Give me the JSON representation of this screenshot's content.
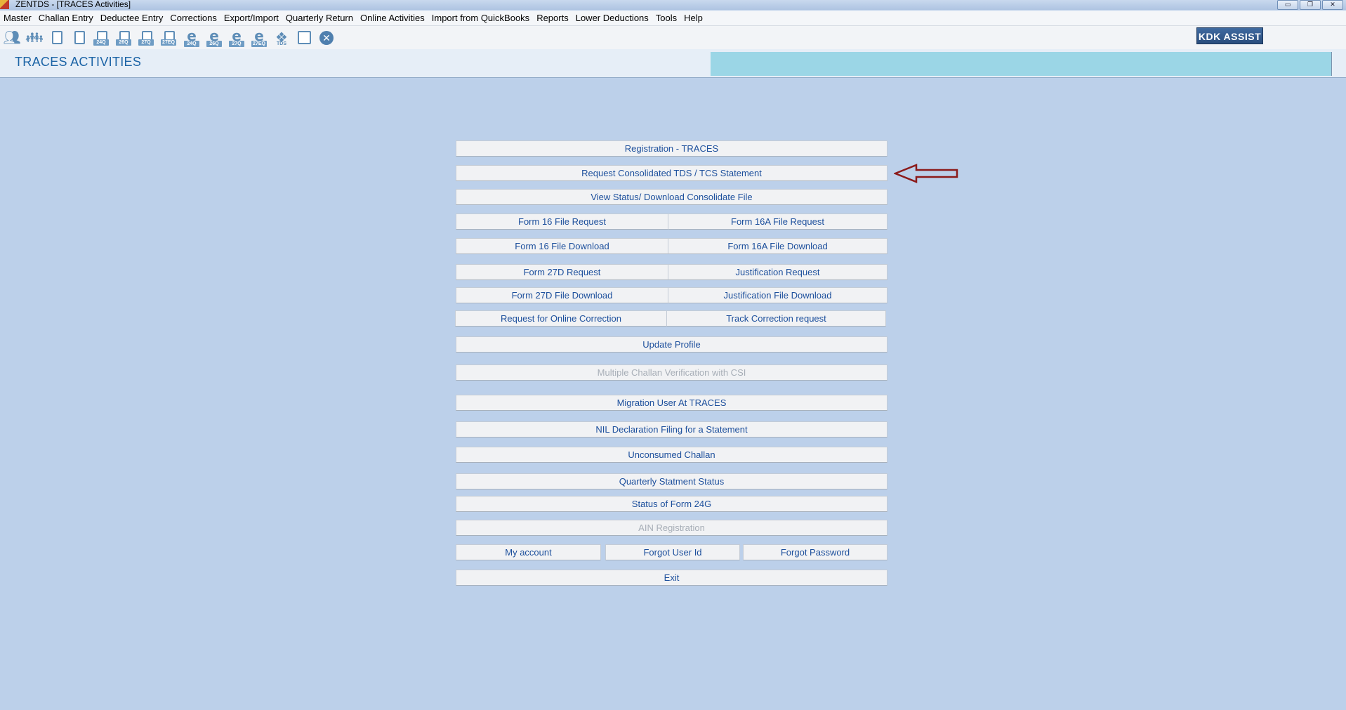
{
  "window": {
    "title": "ZENTDS - [TRACES Activities]",
    "controls": [
      "▭",
      "❐",
      "✕"
    ]
  },
  "menu": [
    "Master",
    "Challan Entry",
    "Deductee Entry",
    "Corrections",
    "Export/Import",
    "Quarterly Return",
    "Online Activities",
    "Import from QuickBooks",
    "Reports",
    "Lower Deductions",
    "Tools",
    "Help"
  ],
  "toolbar": {
    "icons": [
      {
        "name": "people-icon"
      },
      {
        "name": "group-icon"
      },
      {
        "name": "document-person-icon"
      },
      {
        "name": "document-person-2-icon"
      },
      {
        "name": "form-24q-icon",
        "tag": "24Q"
      },
      {
        "name": "form-26q-icon",
        "tag": "26Q"
      },
      {
        "name": "form-27q-icon",
        "tag": "27Q"
      },
      {
        "name": "form-27eq-icon",
        "tag": "27EQ"
      },
      {
        "name": "e-filing-24q-icon",
        "tag": "24Q"
      },
      {
        "name": "e-filing-26q-icon",
        "tag": "26Q"
      },
      {
        "name": "e-filing-27q-icon",
        "tag": "27Q"
      },
      {
        "name": "e-filing-27eq-icon",
        "tag": "27EQ"
      },
      {
        "name": "tds-icon",
        "tag": "TDS"
      },
      {
        "name": "report-icon"
      },
      {
        "name": "close-circle-icon"
      }
    ],
    "kdk_assist": "KDK ASSIST"
  },
  "header": {
    "title": "TRACES ACTIVITIES"
  },
  "buttons": {
    "registration": "Registration - TRACES",
    "request_consolidated": "Request Consolidated TDS / TCS Statement",
    "view_status": "View Status/ Download Consolidate File",
    "form16_request": "Form 16 File Request",
    "form16a_request": "Form 16A File Request",
    "form16_download": "Form 16 File Download",
    "form16a_download": "Form 16A File Download",
    "form27d_request": "Form 27D Request",
    "justification_request": "Justification Request",
    "form27d_download": "Form 27D File Download",
    "justification_download": "Justification File Download",
    "online_correction": "Request for Online Correction",
    "track_correction": "Track Correction request",
    "update_profile": "Update Profile",
    "multiple_challan": "Multiple Challan Verification with CSI",
    "migration_user": "Migration User At TRACES",
    "nil_declaration": "NIL Declaration Filing for a Statement",
    "unconsumed_challan": "Unconsumed Challan",
    "quarterly_status": "Quarterly Statment Status",
    "status_24g": "Status of Form 24G",
    "ain_registration": "AIN Registration",
    "my_account": "My account",
    "forgot_user_id": "Forgot User Id",
    "forgot_password": "Forgot Password",
    "exit": "Exit"
  },
  "colors": {
    "background": "#bcd0ea",
    "button_text": "#1c4f9c",
    "title_text": "#1c64a6",
    "header_panel": "#9bd6e6",
    "arrow": "#8b1a1a"
  }
}
